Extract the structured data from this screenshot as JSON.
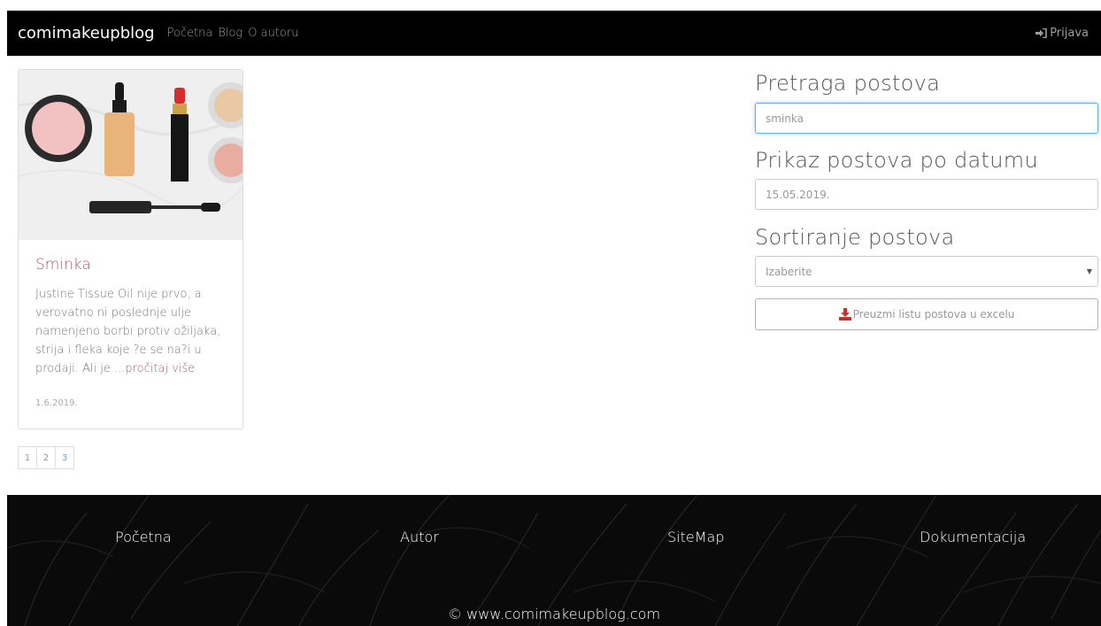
{
  "navbar": {
    "brand": "comimakeupblog",
    "links": [
      "Početna",
      "Blog",
      "O autoru"
    ],
    "login_label": "Prijava",
    "login_icon": "sign-in-icon"
  },
  "card": {
    "image_icon": "makeup-products-image",
    "title": "Sminka",
    "excerpt": "Justine Tissue Oil nije prvo, a verovatno ni poslednje ulje namenjeno borbi protiv ožiljaka, strija i fleka koje ?e se na?i u prodaji. Ali je ...",
    "read_more": "pročitaj više",
    "date": "1.6.2019."
  },
  "pagination": [
    "1",
    "2",
    "3"
  ],
  "sidebar": {
    "search_heading": "Pretraga postova",
    "search_value": "sminka",
    "date_heading": "Prikaz postova po datumu",
    "date_placeholder": "15.05.2019.",
    "sort_heading": "Sortiranje postova",
    "sort_selected": "Izaberite",
    "export_label": "Preuzmi listu postova u excelu",
    "export_icon": "download-icon"
  },
  "footer": {
    "links": [
      "Početna",
      "Autor",
      "SiteMap",
      "Dokumentacija"
    ],
    "copyright": "© www.comimakeupblog.com"
  },
  "colors": {
    "navbar_bg": "#000000",
    "accent": "#a55a7a",
    "download_icon": "#c9302c",
    "pagination_link": "#6aa4d8"
  }
}
